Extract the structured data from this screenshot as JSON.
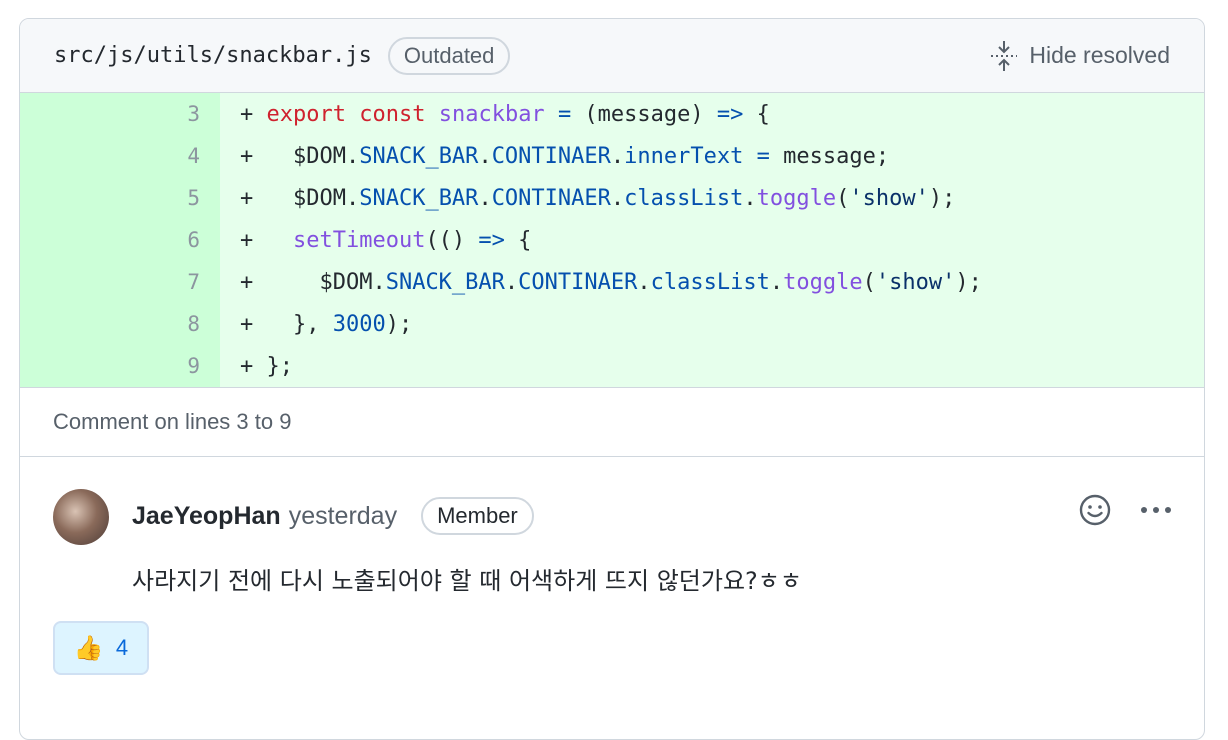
{
  "header": {
    "file_path": "src/js/utils/snackbar.js",
    "outdated_label": "Outdated",
    "hide_resolved_label": "Hide resolved"
  },
  "code": {
    "line_numbers": [
      "3",
      "4",
      "5",
      "6",
      "7",
      "8",
      "9"
    ],
    "lines": [
      [
        {
          "t": "+ ",
          "c": ""
        },
        {
          "t": "export",
          "c": "kw"
        },
        {
          "t": " ",
          "c": ""
        },
        {
          "t": "const",
          "c": "kw"
        },
        {
          "t": " ",
          "c": ""
        },
        {
          "t": "snackbar",
          "c": "fn"
        },
        {
          "t": " ",
          "c": ""
        },
        {
          "t": "=",
          "c": "pr"
        },
        {
          "t": " (message) ",
          "c": ""
        },
        {
          "t": "=>",
          "c": "pr"
        },
        {
          "t": " {",
          "c": ""
        }
      ],
      [
        {
          "t": "+   $DOM.",
          "c": ""
        },
        {
          "t": "SNACK_BAR",
          "c": "pr"
        },
        {
          "t": ".",
          "c": ""
        },
        {
          "t": "CONTINAER",
          "c": "pr"
        },
        {
          "t": ".",
          "c": ""
        },
        {
          "t": "innerText",
          "c": "pr"
        },
        {
          "t": " ",
          "c": ""
        },
        {
          "t": "=",
          "c": "pr"
        },
        {
          "t": " message;",
          "c": ""
        }
      ],
      [
        {
          "t": "+   $DOM.",
          "c": ""
        },
        {
          "t": "SNACK_BAR",
          "c": "pr"
        },
        {
          "t": ".",
          "c": ""
        },
        {
          "t": "CONTINAER",
          "c": "pr"
        },
        {
          "t": ".",
          "c": ""
        },
        {
          "t": "classList",
          "c": "pr"
        },
        {
          "t": ".",
          "c": ""
        },
        {
          "t": "toggle",
          "c": "fn"
        },
        {
          "t": "(",
          "c": ""
        },
        {
          "t": "'show'",
          "c": "st"
        },
        {
          "t": ");",
          "c": ""
        }
      ],
      [
        {
          "t": "+   ",
          "c": ""
        },
        {
          "t": "setTimeout",
          "c": "fn"
        },
        {
          "t": "(() ",
          "c": ""
        },
        {
          "t": "=>",
          "c": "pr"
        },
        {
          "t": " {",
          "c": ""
        }
      ],
      [
        {
          "t": "+     $DOM.",
          "c": ""
        },
        {
          "t": "SNACK_BAR",
          "c": "pr"
        },
        {
          "t": ".",
          "c": ""
        },
        {
          "t": "CONTINAER",
          "c": "pr"
        },
        {
          "t": ".",
          "c": ""
        },
        {
          "t": "classList",
          "c": "pr"
        },
        {
          "t": ".",
          "c": ""
        },
        {
          "t": "toggle",
          "c": "fn"
        },
        {
          "t": "(",
          "c": ""
        },
        {
          "t": "'show'",
          "c": "st"
        },
        {
          "t": ");",
          "c": ""
        }
      ],
      [
        {
          "t": "+   }, ",
          "c": ""
        },
        {
          "t": "3000",
          "c": "pr"
        },
        {
          "t": ");",
          "c": ""
        }
      ],
      [
        {
          "t": "+ };",
          "c": ""
        }
      ]
    ]
  },
  "comment_on": "Comment on lines 3 to 9",
  "comment": {
    "author": "JaeYeopHan",
    "timestamp": "yesterday",
    "role_badge": "Member",
    "body": "사라지기 전에 다시 노출되어야 할 때 어색하게 뜨지 않던가요?ㅎㅎ",
    "reaction": {
      "emoji": "👍",
      "count": "4"
    },
    "icons": [
      "smiley-icon",
      "kebab-menu-icon"
    ]
  },
  "colors": {
    "added_line_bg": "#e6ffec",
    "added_gutter_bg": "#ccffd8",
    "keyword": "#cf222e",
    "function": "#8250df",
    "property": "#0550ae",
    "string": "#0a3069"
  }
}
